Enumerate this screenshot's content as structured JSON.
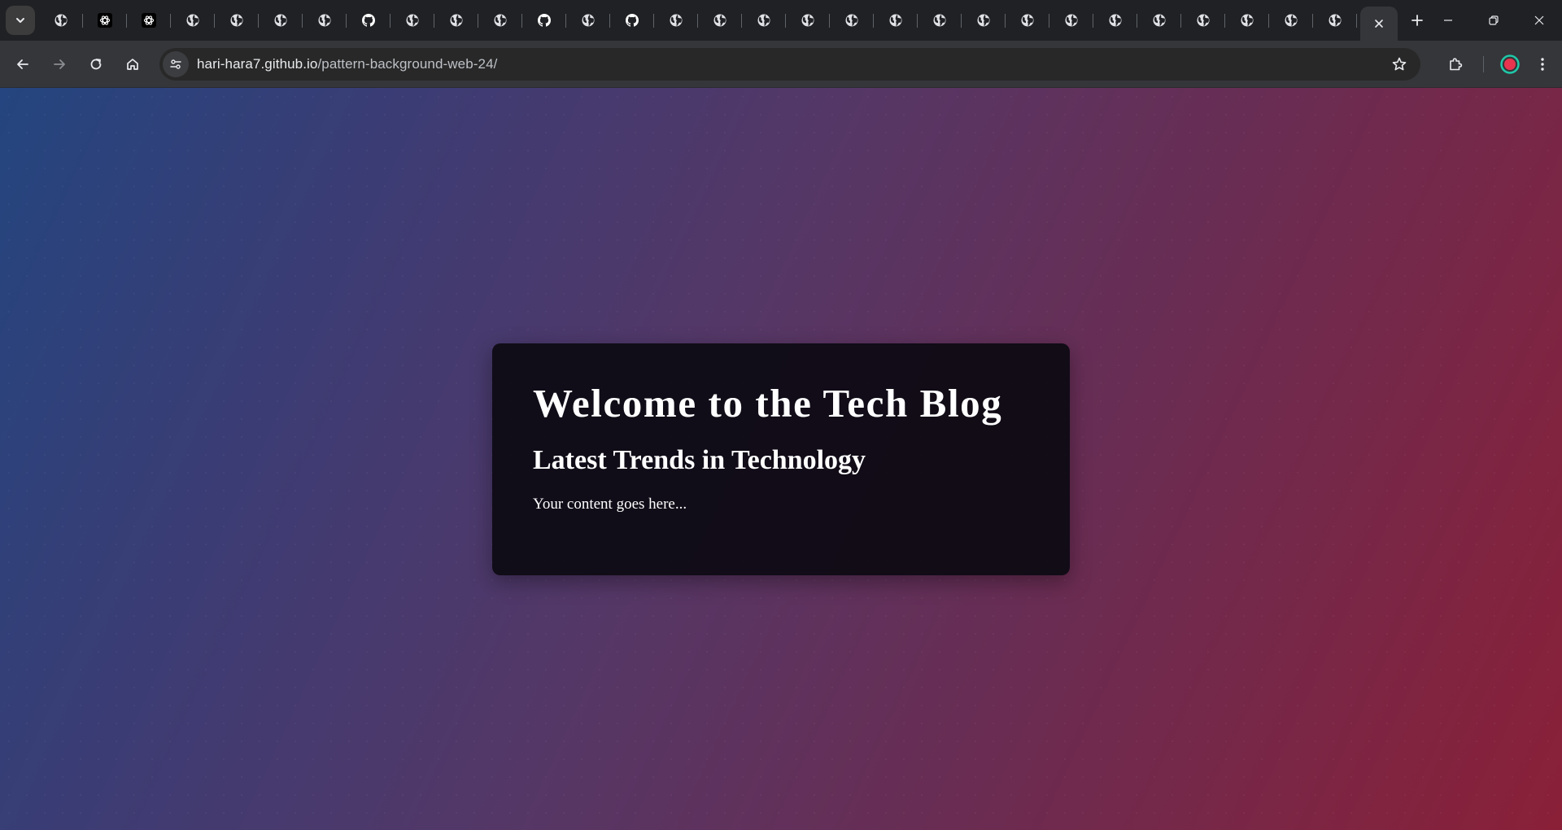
{
  "browser": {
    "tabs": [
      {
        "icon": "globe-icon"
      },
      {
        "icon": "openai-icon"
      },
      {
        "icon": "openai-icon"
      },
      {
        "icon": "globe-icon"
      },
      {
        "icon": "globe-icon"
      },
      {
        "icon": "globe-icon"
      },
      {
        "icon": "globe-icon"
      },
      {
        "icon": "github-icon"
      },
      {
        "icon": "globe-icon"
      },
      {
        "icon": "globe-icon"
      },
      {
        "icon": "globe-icon"
      },
      {
        "icon": "github-icon"
      },
      {
        "icon": "globe-icon"
      },
      {
        "icon": "github-icon"
      },
      {
        "icon": "globe-icon"
      },
      {
        "icon": "globe-icon"
      },
      {
        "icon": "globe-icon"
      },
      {
        "icon": "globe-icon"
      },
      {
        "icon": "globe-icon"
      },
      {
        "icon": "globe-icon"
      },
      {
        "icon": "globe-icon"
      },
      {
        "icon": "globe-icon"
      },
      {
        "icon": "globe-icon"
      },
      {
        "icon": "globe-icon"
      },
      {
        "icon": "globe-icon"
      },
      {
        "icon": "globe-icon"
      },
      {
        "icon": "globe-icon"
      },
      {
        "icon": "globe-icon"
      },
      {
        "icon": "globe-icon"
      },
      {
        "icon": "globe-icon"
      }
    ],
    "active_tab_icon": "close-icon",
    "url_host": "hari-hara7.github.io",
    "url_path": "/pattern-background-web-24/",
    "profile_color": "#e8344e",
    "accent_color": "#1fc8a8"
  },
  "page": {
    "heading": "Welcome to the Tech Blog",
    "subheading": "Latest Trends in Technology",
    "body": "Your content goes here...",
    "gradient_start": "#24457f",
    "gradient_end": "#8a2038",
    "card_color": "#0c0a12"
  }
}
